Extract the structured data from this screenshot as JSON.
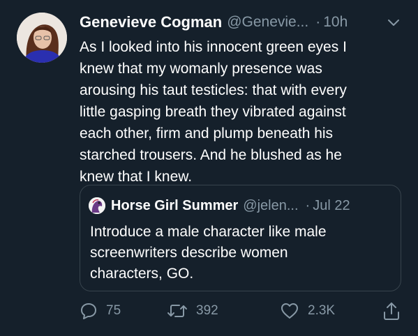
{
  "tweet": {
    "author_name": "Genevieve Cogman",
    "author_handle": "@Genevie...",
    "separator": "·",
    "time": "10h",
    "text": "As I looked into his innocent green eyes I\nknew that my womanly presence was\narousing his taut testicles: that with every\nlittle gasping breath they vibrated against\neach other, firm and plump beneath his\nstarched trousers. And he blushed as he\nknew that I knew."
  },
  "quoted_tweet": {
    "author_name": "Horse Girl Summer",
    "author_handle": "@jelen...",
    "separator": "·",
    "date": "Jul 22",
    "text": "Introduce a male character like male\nscreenwriters describe women\ncharacters, GO."
  },
  "actions": {
    "reply_count": "75",
    "retweet_count": "392",
    "like_count": "2.3K"
  },
  "icons": {
    "reply": "speech-bubble",
    "retweet": "retweet-arrows",
    "like": "heart-outline",
    "share": "share-upload",
    "more": "chevron-down"
  },
  "colors": {
    "background": "#15202b",
    "primary_text": "#ffffff",
    "secondary_text": "#8899a6",
    "border": "#38444d"
  }
}
